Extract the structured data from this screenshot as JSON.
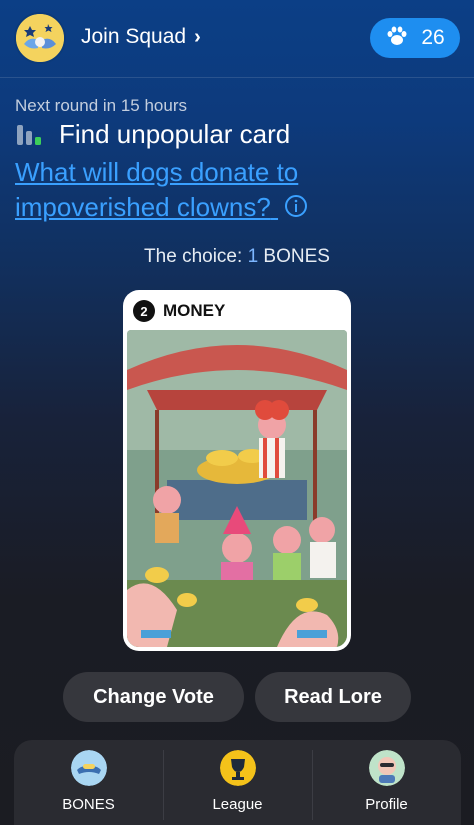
{
  "header": {
    "squad_label": "Join Squad",
    "bones_count": "26"
  },
  "round": {
    "next_round": "Next round in 15 hours",
    "task_title": "Find unpopular card",
    "question": "What will dogs donate to impoverished clowns?"
  },
  "choice": {
    "prefix": "The choice:",
    "count": "1",
    "unit": "BONES"
  },
  "card": {
    "number": "2",
    "label": "MONEY"
  },
  "actions": {
    "change_vote": "Change Vote",
    "read_lore": "Read Lore"
  },
  "tabs": [
    {
      "label": "BONES",
      "icon": "bones-tab-icon"
    },
    {
      "label": "League",
      "icon": "trophy-icon"
    },
    {
      "label": "Profile",
      "icon": "profile-avatar-icon"
    }
  ],
  "colors": {
    "accent_blue": "#1e8ef0",
    "link_blue": "#3aa0ff",
    "button_bg": "#36373d",
    "tabbar_bg": "#2a2b31"
  }
}
